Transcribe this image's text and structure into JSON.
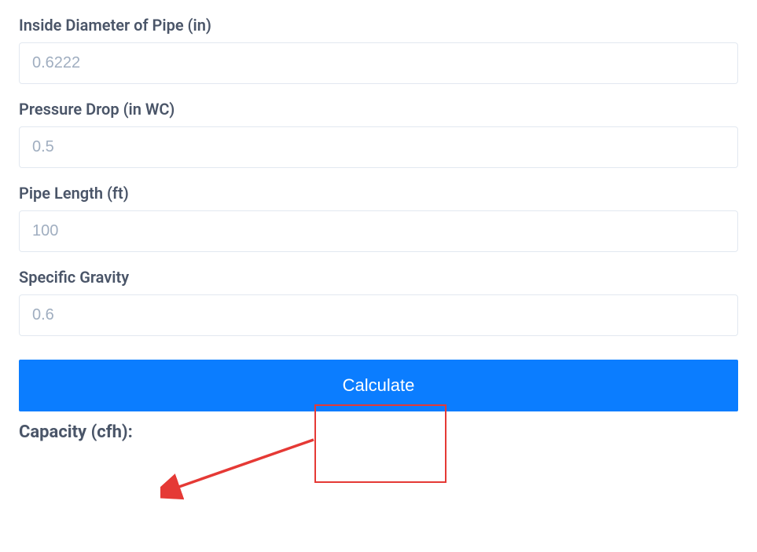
{
  "form": {
    "fields": [
      {
        "label": "Inside Diameter of Pipe (in)",
        "placeholder": "0.6222"
      },
      {
        "label": "Pressure Drop (in WC)",
        "placeholder": "0.5"
      },
      {
        "label": "Pipe Length (ft)",
        "placeholder": "100"
      },
      {
        "label": "Specific Gravity",
        "placeholder": "0.6"
      }
    ],
    "calculate_label": "Calculate",
    "result_label": "Capacity (cfh):"
  }
}
